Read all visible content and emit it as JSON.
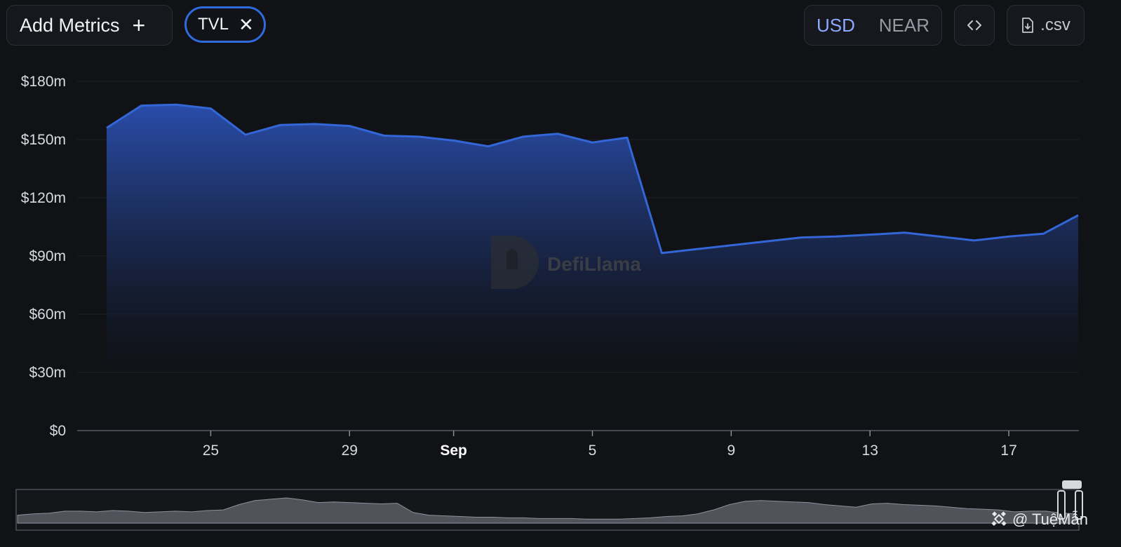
{
  "toolbar": {
    "add_metrics_label": "Add Metrics",
    "add_icon": "plus-icon",
    "metric_chip_label": "TVL",
    "metric_remove_icon": "close-icon",
    "currency_options": [
      "USD",
      "NEAR"
    ],
    "selected_currency": "USD",
    "embed_icon": "code-icon",
    "csv_icon": "file-download-icon",
    "csv_label": ".csv"
  },
  "watermark": {
    "text": "DefiLlama"
  },
  "credit": {
    "text": "@ TuệMẫn"
  },
  "colors": {
    "line": "#3366d6",
    "accent": "#2f6bdc",
    "background": "#101216"
  },
  "chart_data": {
    "type": "area",
    "series": [
      {
        "name": "TVL",
        "x": [
          "Aug 22",
          "Aug 23",
          "Aug 24",
          "Aug 25",
          "Aug 26",
          "Aug 27",
          "Aug 28",
          "Aug 29",
          "Aug 30",
          "Aug 31",
          "Sep 1",
          "Sep 2",
          "Sep 3",
          "Sep 4",
          "Sep 5",
          "Sep 6",
          "Sep 7",
          "Sep 8",
          "Sep 9",
          "Sep 10",
          "Sep 11",
          "Sep 12",
          "Sep 13",
          "Sep 14",
          "Sep 15",
          "Sep 16",
          "Sep 17",
          "Sep 18",
          "Sep 19"
        ],
        "values": [
          156,
          167.5,
          168,
          166,
          152.5,
          157.5,
          158,
          157,
          152,
          151.5,
          149.5,
          146.5,
          151.5,
          153,
          148.5,
          151,
          91.5,
          93.5,
          95.5,
          97.5,
          99.5,
          100,
          101,
          102,
          100,
          98,
          100,
          101.5,
          111
        ]
      }
    ],
    "y_unit": "$m",
    "ylim": [
      0,
      180
    ],
    "y_ticks": [
      "$0",
      "$30m",
      "$60m",
      "$90m",
      "$120m",
      "$150m",
      "$180m"
    ],
    "y_tick_values": [
      0,
      30,
      60,
      90,
      120,
      150,
      180
    ],
    "x_ticks": [
      {
        "label": "25",
        "x": "Aug 25"
      },
      {
        "label": "29",
        "x": "Aug 29"
      },
      {
        "label": "Sep",
        "x": "Sep 1",
        "bold": true
      },
      {
        "label": "5",
        "x": "Sep 5"
      },
      {
        "label": "9",
        "x": "Sep 9"
      },
      {
        "label": "13",
        "x": "Sep 13"
      },
      {
        "label": "17",
        "x": "Sep 17"
      }
    ],
    "grid": true,
    "range_selector": {
      "overview_values": [
        12,
        14,
        15,
        18,
        18,
        17,
        19,
        18,
        16,
        17,
        18,
        17,
        19,
        20,
        28,
        34,
        36,
        38,
        35,
        31,
        32,
        31,
        30,
        29,
        30,
        16,
        12,
        11,
        10,
        9,
        9,
        8,
        8,
        7,
        7,
        7,
        6,
        6,
        6,
        7,
        8,
        10,
        11,
        14,
        20,
        28,
        33,
        34,
        33,
        32,
        31,
        28,
        26,
        24,
        29,
        30,
        28,
        27,
        26,
        24,
        22,
        21,
        20,
        17,
        18,
        18,
        15,
        14
      ]
    }
  }
}
